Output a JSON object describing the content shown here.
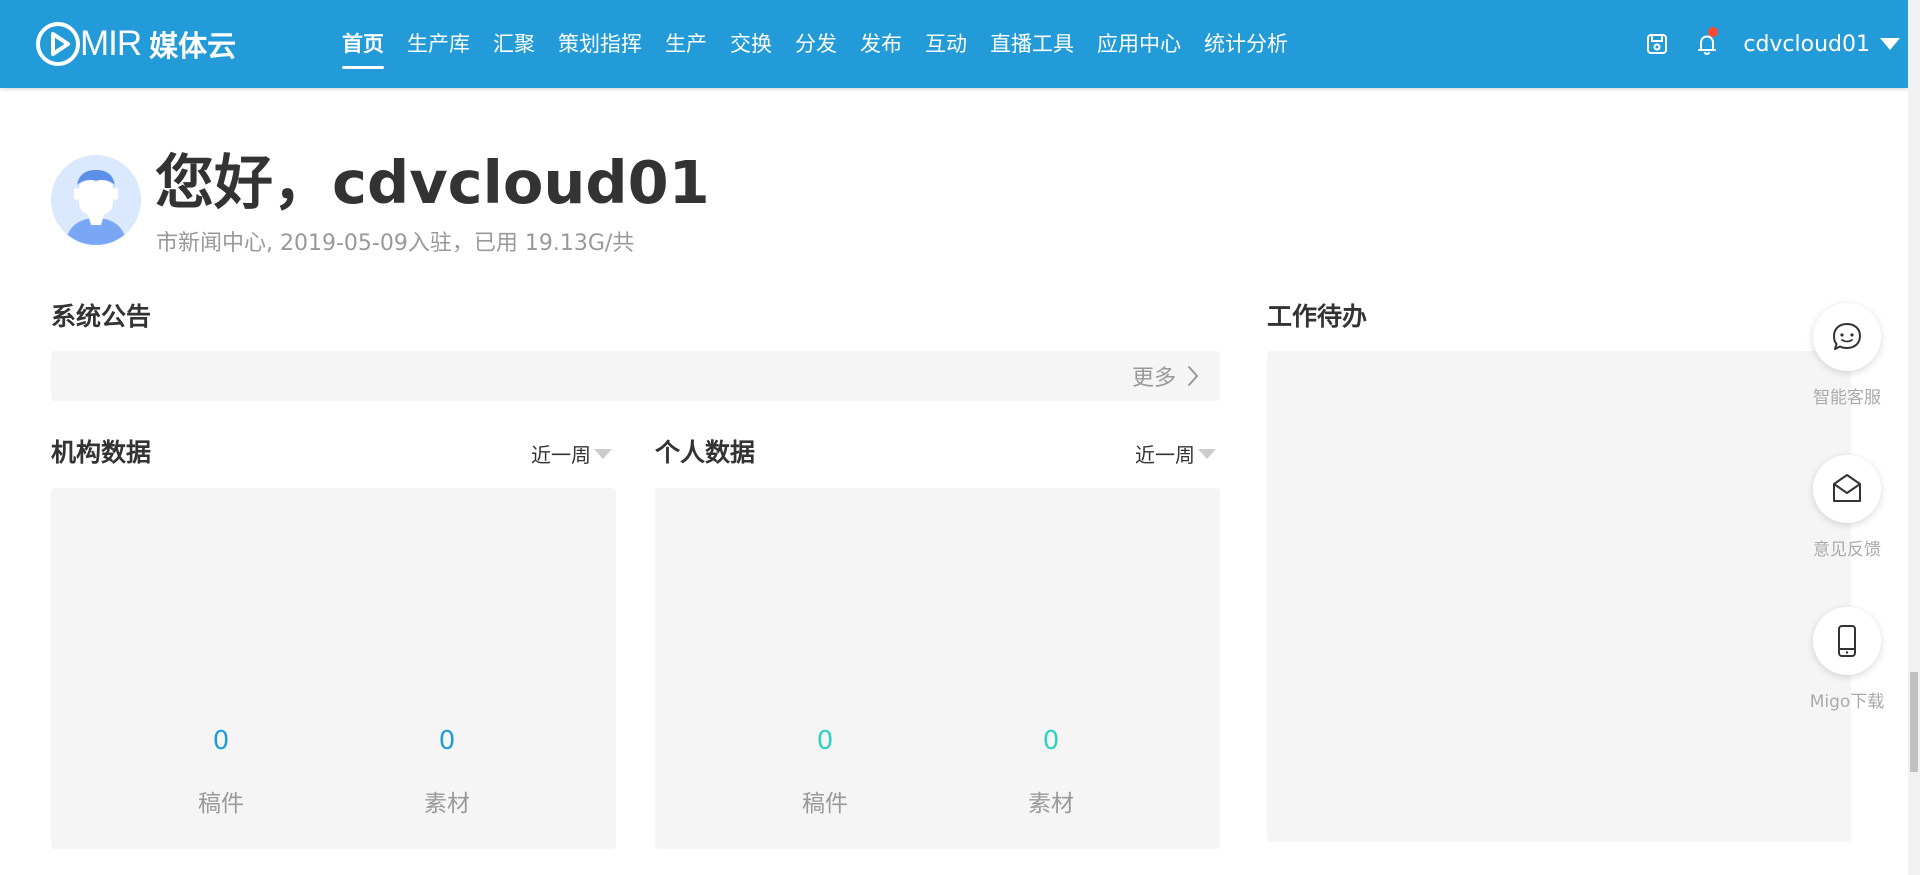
{
  "brand": {
    "logo_letters": "MIR",
    "name_cn": "媒体云"
  },
  "nav": {
    "items": [
      {
        "label": "首页",
        "active": true
      },
      {
        "label": "生产库"
      },
      {
        "label": "汇聚"
      },
      {
        "label": "策划指挥"
      },
      {
        "label": "生产"
      },
      {
        "label": "交换"
      },
      {
        "label": "分发"
      },
      {
        "label": "发布"
      },
      {
        "label": "互动"
      },
      {
        "label": "直播工具"
      },
      {
        "label": "应用中心"
      },
      {
        "label": "统计分析"
      }
    ]
  },
  "user": {
    "username": "cdvcloud01",
    "has_notification": true
  },
  "greeting": {
    "text": "您好，cdvcloud01",
    "info": "市新闻中心, 2019-05-09入驻，已用 19.13G/共"
  },
  "announcement": {
    "title": "系统公告",
    "more": "更多"
  },
  "org_data": {
    "title": "机构数据",
    "period": "近一周",
    "stats": [
      {
        "value": "0",
        "label": "稿件"
      },
      {
        "value": "0",
        "label": "素材"
      }
    ]
  },
  "personal_data": {
    "title": "个人数据",
    "period": "近一周",
    "stats": [
      {
        "value": "0",
        "label": "稿件"
      },
      {
        "value": "0",
        "label": "素材"
      }
    ]
  },
  "todo": {
    "title": "工作待办"
  },
  "float_tools": [
    {
      "label": "智能客服",
      "icon": "chat-bubble-icon"
    },
    {
      "label": "意见反馈",
      "icon": "envelope-icon"
    },
    {
      "label": "Migo下载",
      "icon": "mobile-phone-icon"
    }
  ],
  "colors": {
    "header_bg": "#229bd8",
    "org_stat_color": "#229bd8",
    "personal_stat_color": "#2ed3c0",
    "notification_dot": "#ff4a2e"
  }
}
